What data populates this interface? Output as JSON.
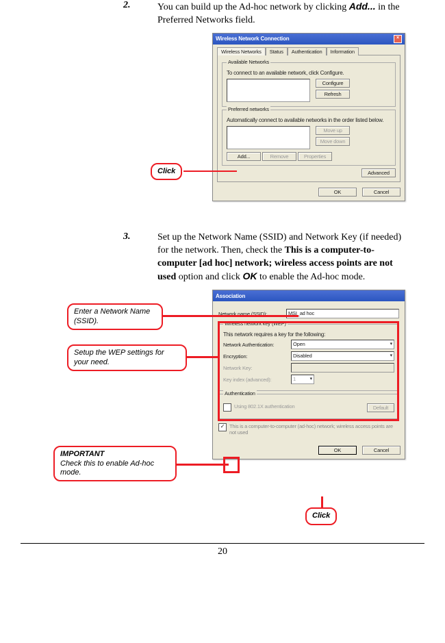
{
  "step2": {
    "num": "2.",
    "text_a": "You can build up the Ad-hoc network by clicking ",
    "text_b": " in the Preferred Networks field.",
    "add_label": "Add..."
  },
  "step3": {
    "num": "3.",
    "text_a": "Set up the Network Name (SSID) and Network Key (if needed) for the network.  Then, check the ",
    "bold1": "This is a computer-to-computer [ad hoc] network; wireless access points are not used",
    "text_b": " option and click ",
    "ok_label": "OK",
    "text_c": " to enable the Ad-hoc mode."
  },
  "dialog1": {
    "title": "Wireless Network Connection",
    "tabs": {
      "t1": "Wireless Networks",
      "t2": "Status",
      "t3": "Authentication",
      "t4": "Information"
    },
    "avail_legend": "Available Networks",
    "avail_text": "To connect to an available network, click Configure.",
    "configure": "Configure",
    "refresh": "Refresh",
    "pref_legend": "Preferred networks",
    "pref_text": "Automatically connect to available networks in the order listed below.",
    "moveup": "Move up",
    "movedown": "Move down",
    "add": "Add...",
    "remove": "Remove",
    "properties": "Properties",
    "advanced": "Advanced",
    "ok": "OK",
    "cancel": "Cancel"
  },
  "dialog2": {
    "title": "Association",
    "name_label": "Network name (SSID):",
    "name_value": "MSI_ad hoc",
    "wep_legend": "Wireless network key (WEP)",
    "wep_text": "This network requires a key for the following:",
    "auth_label": "Network Authentication:",
    "auth_value": "Open",
    "enc_label": "Encryption:",
    "enc_value": "Disabled",
    "key_label": "Network Key:",
    "idx_label": "Key index (advanced):",
    "idx_value": "1",
    "auth8021x": "Using 802.1X authentication",
    "auth8021x_btn": "Default",
    "adhoc_text": "This is a computer-to-computer (ad-hoc) network; wireless access points are not used",
    "auth_legend": "Authentication",
    "ok": "OK",
    "cancel": "Cancel"
  },
  "callouts": {
    "click": "Click",
    "ssid": "Enter a Network Name (SSID).",
    "wep": "Setup the WEP settings for your need.",
    "imp_title": "IMPORTANT",
    "imp_text": "Check this to enable Ad-hoc mode."
  },
  "page_number": "20"
}
